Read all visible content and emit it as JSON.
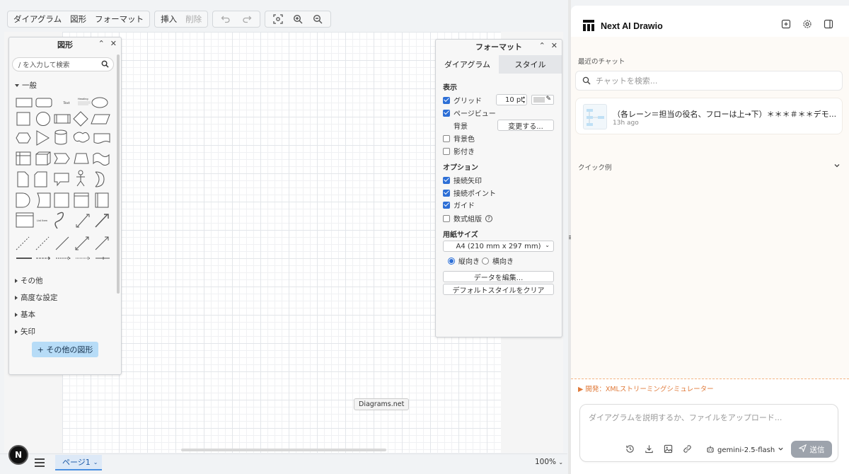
{
  "toolbar": {
    "menu": [
      "ダイアグラム",
      "図形",
      "フォーマット"
    ],
    "insert": "挿入",
    "delete": "削除"
  },
  "shapes_panel": {
    "title": "図形",
    "search_placeholder": "/ を入力して検索",
    "general": "一般",
    "sections": [
      "その他",
      "高度な設定",
      "基本",
      "矢印"
    ],
    "more_shapes": "+ その他の図形",
    "small_labels": {
      "text": "Text",
      "heading": "Heading",
      "list_item": "List Item"
    }
  },
  "format_panel": {
    "title": "フォーマット",
    "tab_diagram": "ダイアグラム",
    "tab_style": "スタイル",
    "view_label": "表示",
    "grid": "グリッド",
    "grid_size": "10 pt",
    "page_view": "ページビュー",
    "background": "背景",
    "change_button": "変更する...",
    "bg_color": "背景色",
    "shadow": "影付き",
    "options_label": "オプション",
    "connection_arrows": "接続矢印",
    "connection_points": "接続ポイント",
    "guides": "ガイド",
    "math": "数式組版",
    "paper_label": "用紙サイズ",
    "paper_size": "A4 (210 mm x 297 mm)",
    "portrait": "縦向き",
    "landscape": "横向き",
    "edit_data": "データを編集...",
    "clear_style": "デフォルトスタイルをクリア",
    "checkbox_states": {
      "grid": true,
      "page_view": true,
      "bg_color": false,
      "shadow": false,
      "connection_arrows": true,
      "connection_points": true,
      "guides": true,
      "math": false
    },
    "orientation": "portrait"
  },
  "canvas": {
    "watermark": "Diagrams.net"
  },
  "bottom": {
    "logo": "N",
    "page_tab": "ページ1",
    "zoom": "100%"
  },
  "chat": {
    "brand": "Next AI Drawio",
    "recent_label": "最近のチャット",
    "search_placeholder": "チャットを検索...",
    "item_title": "（各レーン＝担当の役名、フローは上→下）＊＊＊＃＊＊デモ...",
    "item_time": "13h ago",
    "quick_label": "クイック例",
    "dev_label": "▶ 開発：XMLストリーミングシミュレーター",
    "input_placeholder": "ダイアグラムを説明するか、ファイルをアップロード...",
    "model": "gemini-2.5-flash",
    "send": "送信"
  },
  "colors": {
    "accent_blue": "#2d6fd6",
    "more_shapes_bg": "#b7dcf7",
    "dev_orange": "#e07a3a",
    "send_bg": "#9da3ac"
  },
  "icons": [
    "undo-icon",
    "redo-icon",
    "fit-icon",
    "zoom-in-icon",
    "zoom-out-icon",
    "search-icon",
    "close-icon",
    "collapse-icon",
    "new-chat-icon",
    "gear-icon",
    "panel-toggle-icon",
    "history-icon",
    "download-icon",
    "image-icon",
    "link-icon",
    "bot-icon",
    "send-icon",
    "chevron-down-icon"
  ]
}
